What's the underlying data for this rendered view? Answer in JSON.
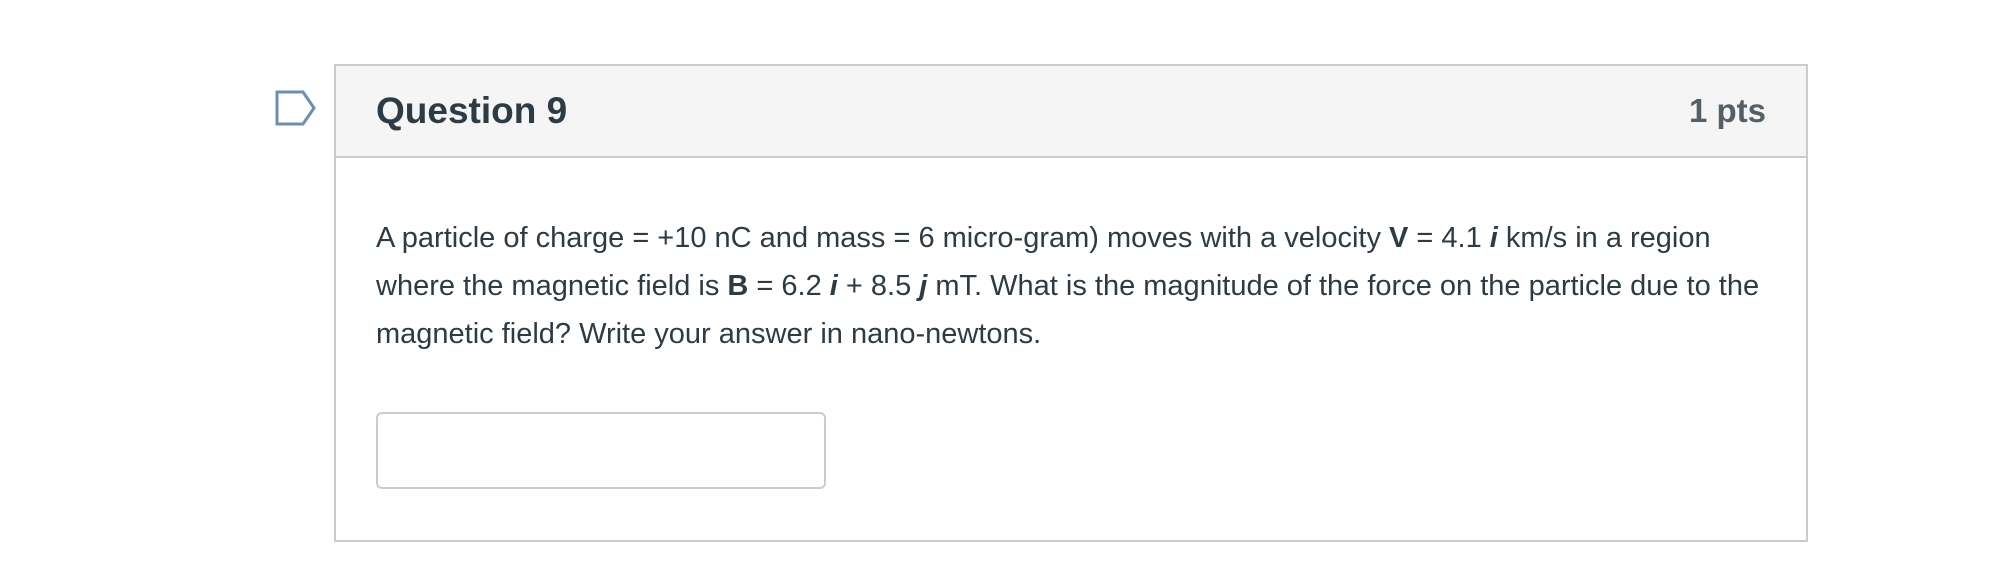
{
  "question": {
    "title": "Question 9",
    "points": "1 pts",
    "text_segments": [
      "A particle of charge = +10 nC and mass = 6 micro-gram) moves with a velocity ",
      "V",
      " = 4.1 ",
      "i",
      " km/s in a region where the magnetic field is ",
      "B",
      " = 6.2 ",
      "i",
      " + 8.5 ",
      "j",
      " mT. What is the magnitude of the force on the particle due to the magnetic field? Write your answer in nano-newtons."
    ]
  },
  "answer": {
    "value": "",
    "placeholder": ""
  },
  "icons": {
    "flag": "flag-question-icon"
  },
  "colors": {
    "flag_stroke": "#6b8fb3",
    "border": "#c7cdd1",
    "header_bg": "#f5f5f5",
    "text": "#2d3b45"
  }
}
